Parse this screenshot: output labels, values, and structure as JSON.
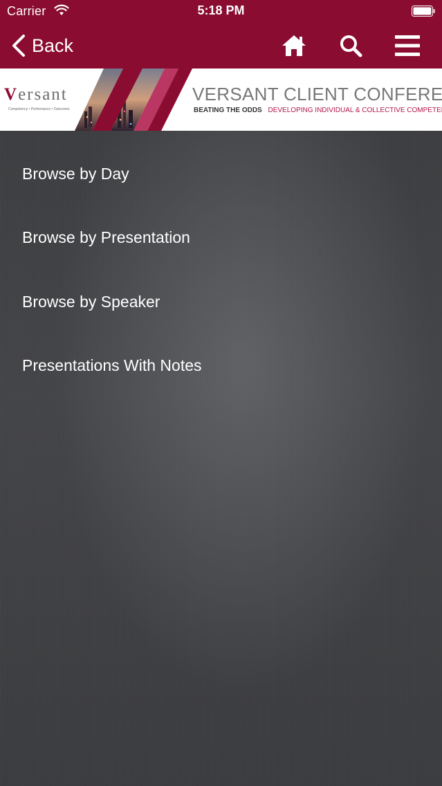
{
  "status_bar": {
    "carrier": "Carrier",
    "time": "5:18 PM"
  },
  "nav": {
    "back_label": "Back",
    "icons": [
      "home-icon",
      "search-icon",
      "menu-icon"
    ]
  },
  "banner": {
    "logo_word_rest": "ersant",
    "logo_word_first": "V",
    "logo_tagline": "Competency • Performance • Outcomes",
    "title": "VERSANT CLIENT CONFERENCE",
    "subtitle_left": "BEATING THE ODDS",
    "subtitle_right": "DEVELOPING INDIVIDUAL & COLLECTIVE COMPETENCE"
  },
  "menu": {
    "items": [
      {
        "label": "Browse by Day"
      },
      {
        "label": "Browse by Presentation"
      },
      {
        "label": "Browse by Speaker"
      },
      {
        "label": "Presentations With Notes"
      }
    ]
  },
  "colors": {
    "brand": "#8a0c31",
    "accent": "#b0174a",
    "background": "#3a3b3d"
  }
}
